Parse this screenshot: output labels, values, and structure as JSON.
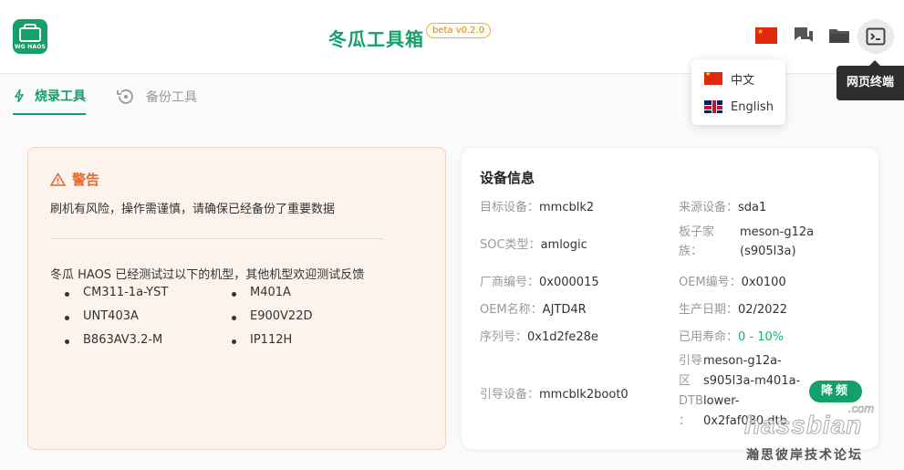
{
  "header": {
    "logo_text": "WG HAOS",
    "title": "冬瓜工具箱",
    "version_badge": "beta v0.2.0",
    "icons": [
      "china-flag-icon",
      "chat-icon",
      "folder-icon",
      "terminal-icon"
    ],
    "tooltip": "网页终端"
  },
  "language_menu": {
    "items": [
      {
        "flag": "china-flag-icon",
        "label": "中文"
      },
      {
        "flag": "uk-flag-icon",
        "label": "English"
      }
    ]
  },
  "tabs": [
    {
      "label": "烧录工具",
      "icon": "lightning-icon",
      "active": true
    },
    {
      "label": "备份工具",
      "icon": "backup-icon",
      "active": false
    }
  ],
  "warning": {
    "title": "警告",
    "message": "刷机有风险，操作需谨慎，请确保已经备份了重要数据",
    "tested_intro": "冬瓜 HAOS 已经测试过以下的机型，其他机型欢迎测试反馈",
    "models": [
      "CM311-1a-YST",
      "M401A",
      "UNT403A",
      "E900V22D",
      "B863AV3.2-M",
      "IP112H"
    ]
  },
  "device_info": {
    "title": "设备信息",
    "target_device_label": "目标设备：",
    "target_device": "mmcblk2",
    "source_device_label": "来源设备：",
    "source_device": "sda1",
    "soc_label": "SOC类型：",
    "soc": "amlogic",
    "board_family_label_1": "板子家",
    "board_family_label_2": "族：",
    "board_family_1": "meson-g12a",
    "board_family_2": "(s905l3a)",
    "vendor_label": "厂商编号：",
    "vendor": "0x000015",
    "oem_id_label": "OEM编号：",
    "oem_id": "0x0100",
    "oem_name_label": "OEM名称：",
    "oem_name": "AJTD4R",
    "mfg_date_label": "生产日期：",
    "mfg_date": "02/2022",
    "serial_label": "序列号：",
    "serial": "0x1d2fe28e",
    "lifetime_label": "已用寿命：",
    "lifetime": "0 - 10%",
    "boot_device_label": "引导设备：",
    "boot_device": "mmcblk2boot0",
    "boot_dtb_label_1": "引导",
    "boot_dtb_label_2": "区",
    "boot_dtb_label_3": "DTB",
    "boot_dtb_label_4": "：",
    "boot_dtb_1": "meson-g12a-",
    "boot_dtb_2": "s905l3a-m401a-",
    "boot_dtb_3": "lower-",
    "boot_dtb_4": "0x2faf080.dtb",
    "badge": "降频"
  },
  "watermark": {
    "brand": "hassbian",
    "tld": ".com",
    "subtitle": "瀚思彼岸技术论坛"
  },
  "colors": {
    "brand_green": "#14a06a",
    "warning_orange": "#e26a2c",
    "warning_bg": "#fdf3ed",
    "badge_border": "#f0b232"
  }
}
